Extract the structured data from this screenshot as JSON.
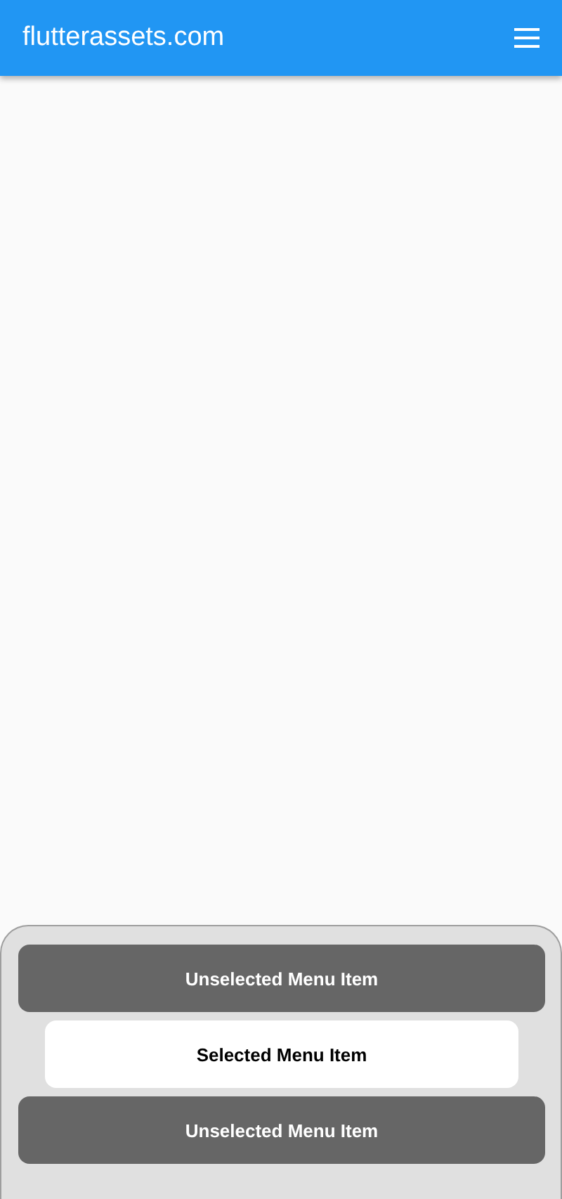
{
  "app_bar": {
    "title": "flutterassets.com"
  },
  "menu": [
    {
      "label": "Unselected Menu Item",
      "selected": false
    },
    {
      "label": "Selected Menu Item",
      "selected": true
    },
    {
      "label": "Unselected Menu Item",
      "selected": false
    }
  ]
}
